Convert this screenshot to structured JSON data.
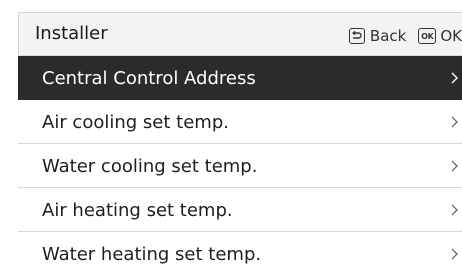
{
  "header": {
    "title": "Installer",
    "back_label": "Back",
    "ok_icon_text": "OK",
    "ok_label": "OK"
  },
  "menu": {
    "items": [
      {
        "label": "Central Control Address",
        "selected": true
      },
      {
        "label": "Air cooling set temp.",
        "selected": false
      },
      {
        "label": "Water cooling set temp.",
        "selected": false
      },
      {
        "label": "Air heating set temp.",
        "selected": false
      },
      {
        "label": "Water heating set temp.",
        "selected": false
      }
    ]
  },
  "colors": {
    "header_background": "#f3f3f3",
    "selected_background": "#2b2b2b",
    "selected_text": "#ffffff",
    "text": "#1e1e1e",
    "divider": "#d9d9d9"
  },
  "icons": {
    "back": "back-icon",
    "ok": "ok-icon",
    "item_arrow": "chevron-right-icon"
  }
}
